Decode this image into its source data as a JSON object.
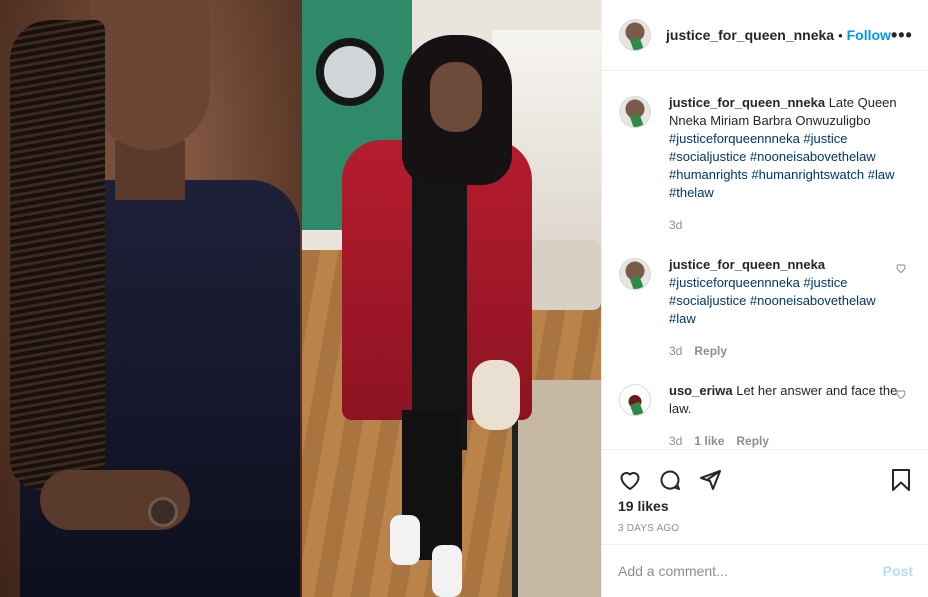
{
  "post": {
    "username": "justice_for_queen_nneka",
    "follow_label": "Follow",
    "more_icon": "more-options-icon"
  },
  "comments": [
    {
      "username": "justice_for_queen_nneka",
      "text": "Late Queen Nneka Miriam Barbra Onwuzuligbo",
      "hashtags": "#justiceforqueennneka #justice #socialjustice #nooneisabovethelaw #humanrights #humanrightswatch #law #thelaw",
      "time": "3d"
    },
    {
      "username": "justice_for_queen_nneka",
      "hashtags": "#justiceforqueennneka #justice #socialjustice #nooneisabovethelaw #law",
      "time": "3d",
      "reply_label": "Reply"
    },
    {
      "username": "uso_eriwa",
      "text": "Let her answer and face the law.",
      "time": "3d",
      "likes": "1 like",
      "reply_label": "Reply"
    }
  ],
  "actions": {
    "likes": "19 likes",
    "ago": "3 DAYS AGO"
  },
  "add_comment": {
    "placeholder": "Add a comment...",
    "post_label": "Post"
  },
  "colors": {
    "accent": "#0095f6",
    "hashtag": "#00376b",
    "muted": "#8e8e8e",
    "post_disabled": "#b2dffc"
  }
}
